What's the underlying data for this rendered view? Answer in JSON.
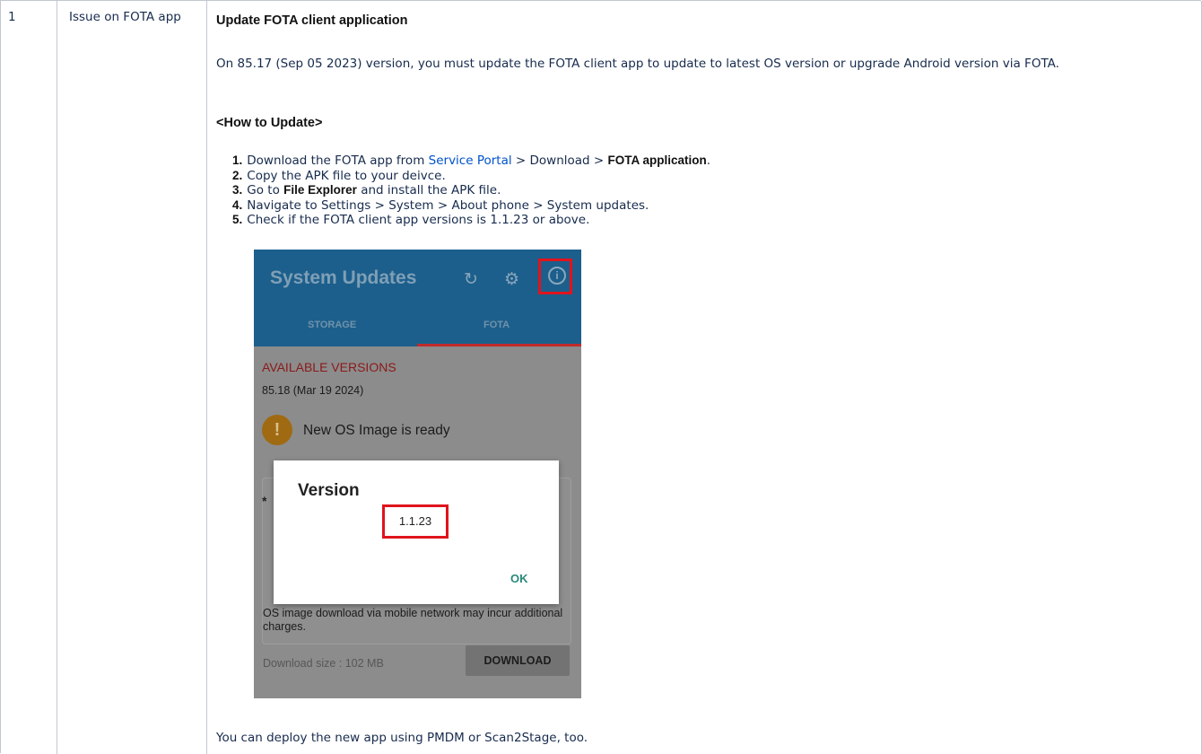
{
  "row": {
    "number": "1",
    "issue": "Issue on FOTA app",
    "title": "Update FOTA client application",
    "intro": "On 85.17 (Sep 05 2023) version, you must update the FOTA client app to update to latest OS version or upgrade Android version via FOTA.",
    "how_to_heading": "<How to Update>",
    "steps": [
      {
        "n": "1.",
        "pre": "Download the FOTA app from ",
        "link": "Service Portal",
        "mid": " > Download > ",
        "bold": "FOTA application",
        "post": "."
      },
      {
        "n": "2.",
        "text": "Copy the APK file to your deivce."
      },
      {
        "n": "3.",
        "pre": "Go to ",
        "bold": "File Explorer",
        "post": " and install the APK file."
      },
      {
        "n": "4.",
        "text": "Navigate to Settings > System > About phone > System updates."
      },
      {
        "n": "5.",
        "text": "Check if the FOTA client app versions is 1.1.23 or above."
      }
    ],
    "footer": "You can deploy the new app using PMDM or Scan2Stage, too."
  },
  "screenshot": {
    "app_title": "System Updates",
    "tabs": [
      "STORAGE",
      "FOTA"
    ],
    "available_label": "AVAILABLE VERSIONS",
    "available_version": "85.18 (Mar 19 2024)",
    "status": "New OS Image is ready",
    "card_bullet": "*",
    "card_text": "OS image download via mobile network may incur additional charges.",
    "download_size": "Download size : 102 MB",
    "download_button": "DOWNLOAD",
    "dialog_title": "Version",
    "dialog_version": "1.1.23",
    "dialog_ok": "OK",
    "icons": [
      "sync-icon",
      "gear-icon",
      "info-icon",
      "warning-icon"
    ]
  }
}
